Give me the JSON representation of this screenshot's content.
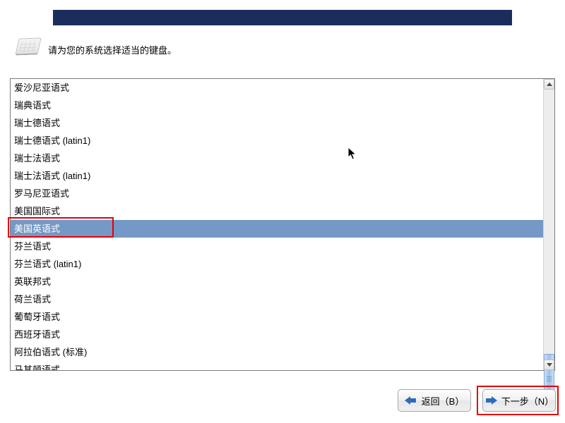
{
  "instruction_text": "请为您的系统选择适当的键盘。",
  "keyboard_layouts": [
    {
      "label": "爱沙尼亚语式",
      "selected": false
    },
    {
      "label": "瑞典语式",
      "selected": false
    },
    {
      "label": "瑞士德语式",
      "selected": false
    },
    {
      "label": "瑞士德语式 (latin1)",
      "selected": false
    },
    {
      "label": "瑞士法语式",
      "selected": false
    },
    {
      "label": "瑞士法语式 (latin1)",
      "selected": false
    },
    {
      "label": "罗马尼亚语式",
      "selected": false
    },
    {
      "label": "美国国际式",
      "selected": false
    },
    {
      "label": "美国英语式",
      "selected": true
    },
    {
      "label": "芬兰语式",
      "selected": false
    },
    {
      "label": "芬兰语式 (latin1)",
      "selected": false
    },
    {
      "label": "英联邦式",
      "selected": false
    },
    {
      "label": "荷兰语式",
      "selected": false
    },
    {
      "label": "葡萄牙语式",
      "selected": false
    },
    {
      "label": "西班牙语式",
      "selected": false
    },
    {
      "label": "阿拉伯语式 (标准)",
      "selected": false
    },
    {
      "label": "马其顿语式",
      "selected": false
    }
  ],
  "buttons": {
    "back_label": "返回（B）",
    "next_label": "下一步（N）"
  }
}
